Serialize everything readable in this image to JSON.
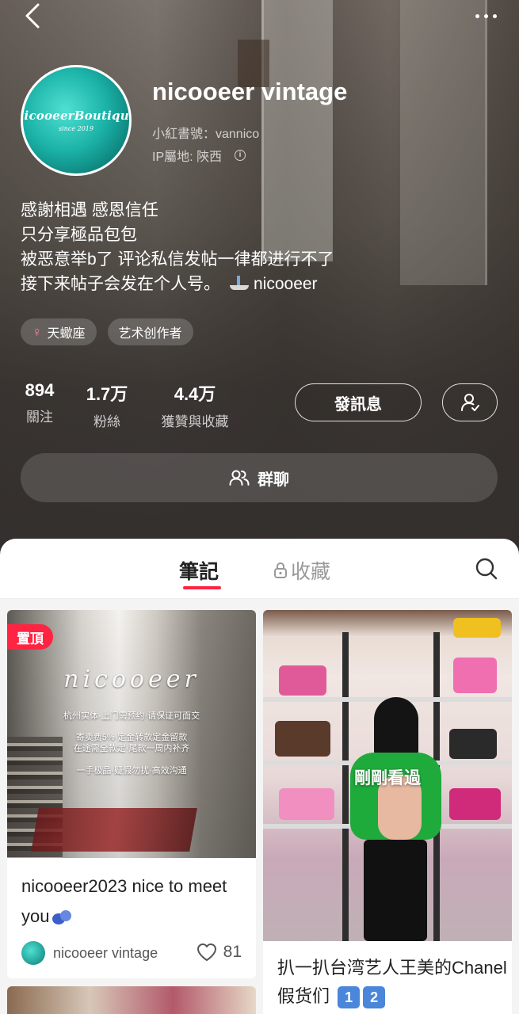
{
  "header": {
    "username": "nicooeer vintage",
    "red_id": "小紅書號：vannico",
    "ip_location": "IP屬地: 陝西"
  },
  "avatar": {
    "logo_text": "nicooeerBoutique",
    "logo_since": "since 2019"
  },
  "bio": {
    "lines": [
      "感謝相遇  感恩信任",
      "只分享極品包包",
      "被恶意举b了 评论私信发帖一律都进行不了",
      "接下来帖子会发在个人号。"
    ],
    "handle": "nicooeer"
  },
  "tags": [
    {
      "label": "天蠍座",
      "icon": "female-icon"
    },
    {
      "label": "艺术创作者"
    }
  ],
  "stats": [
    {
      "value": "894",
      "label": "關注"
    },
    {
      "value": "1.7万",
      "label": "粉絲"
    },
    {
      "value": "4.4万",
      "label": "獲贊與收藏"
    }
  ],
  "actions": {
    "message_label": "發訊息",
    "group_chat_label": "群聊"
  },
  "tabs": {
    "notes": "筆記",
    "collections": "收藏"
  },
  "feed": [
    {
      "pinned_label": "置頂",
      "overlay_script": "nicooeer",
      "overlay_lines": [
        "杭州实体·上门需预约·请保证可面交",
        "寄卖费5%·定金转款定金留款",
        "在途需全款定·尾款一周内补齐",
        "一手极品·疑假勿扰·高效沟通"
      ],
      "title": "nicooeer2023 nice to meet you",
      "author": "nicooeer vintage",
      "likes": "81"
    },
    {
      "recent_label": "剛剛看過",
      "title": "扒一扒台湾艺人王美的Chanel假货们",
      "key_badges": [
        "1",
        "2"
      ]
    }
  ],
  "colors": {
    "accent": "#ff2442",
    "avatar_teal": "#1cb3a8"
  }
}
